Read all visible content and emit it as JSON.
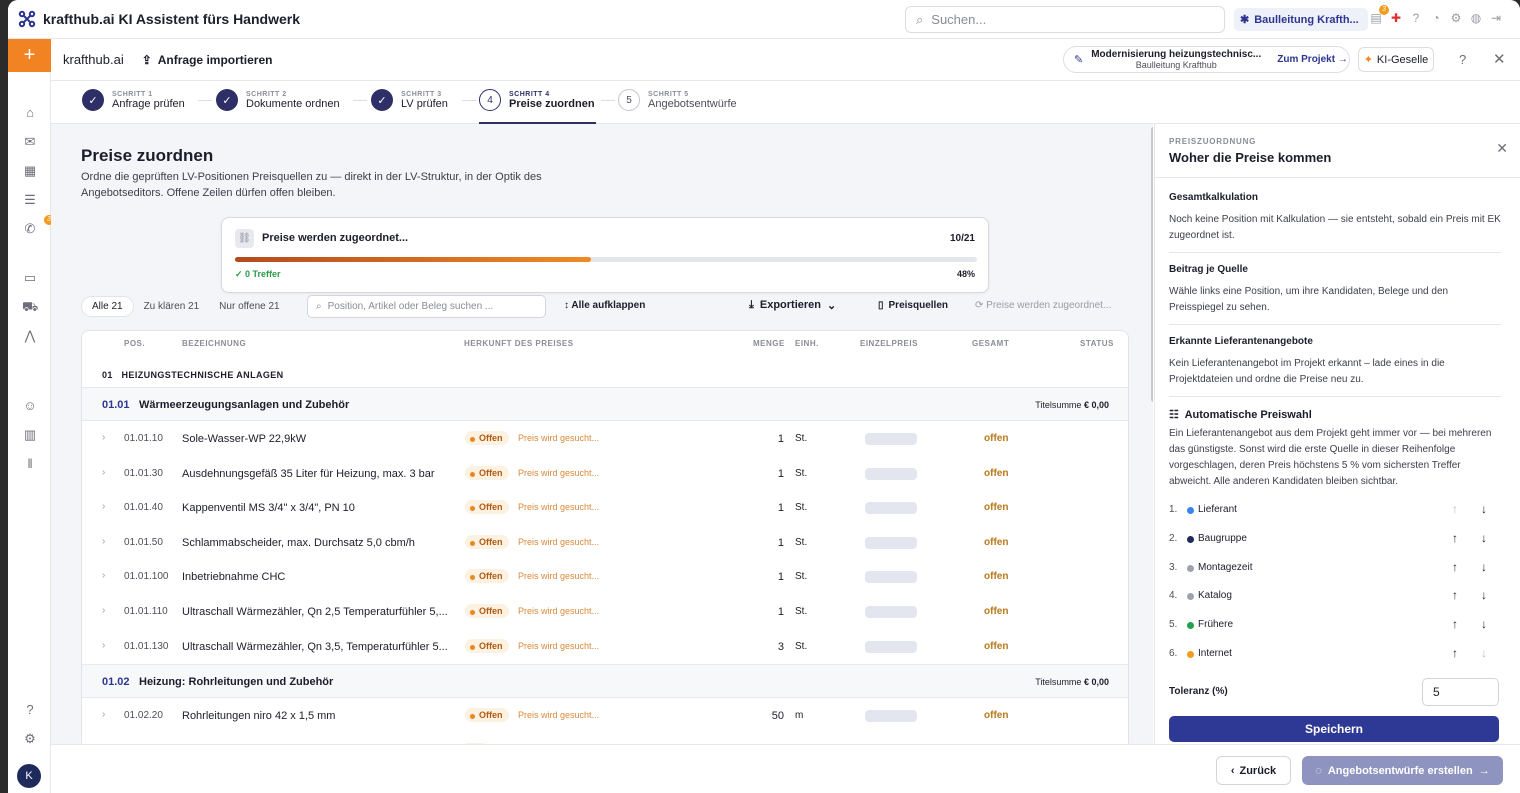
{
  "app": {
    "title": "krafthub.ai KI Assistent fürs Handwerk"
  },
  "topbar": {
    "search_placeholder": "Suchen...",
    "org": "Baulleitung Krafth...",
    "notif_count": "3"
  },
  "sidebar": {
    "plus": "+",
    "badge": "3",
    "avatar": "K"
  },
  "subbar": {
    "crumb": "krafthub.ai",
    "import": "Anfrage importieren",
    "project_title": "Modernisierung heizungstechnisc...",
    "project_sub": "Baulleitung Krafthub",
    "project_link": "Zum Projekt →",
    "ki": "KI-Geselle"
  },
  "steps": [
    {
      "kicker": "SCHRITT 1",
      "name": "Anfrage prüfen",
      "mark": "✓"
    },
    {
      "kicker": "SCHRITT 2",
      "name": "Dokumente ordnen",
      "mark": "✓"
    },
    {
      "kicker": "SCHRITT 3",
      "name": "LV prüfen",
      "mark": "✓"
    },
    {
      "kicker": "SCHRITT 4",
      "name": "Preise zuordnen",
      "mark": "4"
    },
    {
      "kicker": "SCHRITT 5",
      "name": "Angebotsentwürfe",
      "mark": "5"
    }
  ],
  "main": {
    "title": "Preise zuordnen",
    "intro": "Ordne die geprüften LV-Positionen Preisquellen zu — direkt in der LV-Struktur, in der Optik des Angebotseditors. Offene Zeilen dürfen offen bleiben."
  },
  "progress": {
    "title": "Preise werden zugeordnet...",
    "count": "10/21",
    "fraction": 0.48,
    "treffer": "✓ 0 Treffer",
    "pct": "48%"
  },
  "filters": {
    "all": "Alle 21",
    "clarify": "Zu klären 21",
    "open": "Nur offene 21",
    "search_placeholder": "Position, Artikel oder Beleg suchen ...",
    "expand": "Alle aufklappen",
    "export": "Exportieren",
    "sources": "Preisquellen",
    "status": "Preise werden zugeordnet..."
  },
  "table": {
    "headers": {
      "pos": "POS.",
      "bez": "BEZEICHNUNG",
      "herkunft": "HERKUNFT DES PREISES",
      "menge": "MENGE",
      "einh": "EINH.",
      "ep": "EINZELPREIS",
      "gesamt": "GESAMT",
      "status": "STATUS"
    },
    "group": "01   HEIZUNGSTECHNISCHE ANLAGEN",
    "sub1": {
      "id": "01.01",
      "name": "Wärmeerzeugungsanlagen und Zubehör",
      "sum_label": "Titelsumme",
      "sum": "€ 0,00"
    },
    "sub2": {
      "id": "01.02",
      "name": "Heizung: Rohrleitungen und Zubehör",
      "sum_label": "Titelsumme",
      "sum": "€ 0,00"
    },
    "rows": [
      {
        "pos": "01.01.10",
        "bez": "Sole-Wasser-WP 22,9kW",
        "tag": "Offen",
        "src": "Preis wird gesucht...",
        "menge": "1",
        "einh": "St.",
        "status": "offen"
      },
      {
        "pos": "01.01.30",
        "bez": "Ausdehnungsgefäß 35 Liter für Heizung, max. 3 bar",
        "tag": "Offen",
        "src": "Preis wird gesucht...",
        "menge": "1",
        "einh": "St.",
        "status": "offen"
      },
      {
        "pos": "01.01.40",
        "bez": "Kappenventil MS 3/4\" x 3/4\", PN 10",
        "tag": "Offen",
        "src": "Preis wird gesucht...",
        "menge": "1",
        "einh": "St.",
        "status": "offen"
      },
      {
        "pos": "01.01.50",
        "bez": "Schlammabscheider, max. Durchsatz 5,0 cbm/h",
        "tag": "Offen",
        "src": "Preis wird gesucht...",
        "menge": "1",
        "einh": "St.",
        "status": "offen"
      },
      {
        "pos": "01.01.100",
        "bez": "Inbetriebnahme CHC",
        "tag": "Offen",
        "src": "Preis wird gesucht...",
        "menge": "1",
        "einh": "St.",
        "status": "offen"
      },
      {
        "pos": "01.01.110",
        "bez": "Ultraschall Wärmezähler, Qn 2,5 Temperaturfühler 5,...",
        "tag": "Offen",
        "src": "Preis wird gesucht...",
        "menge": "1",
        "einh": "St.",
        "status": "offen"
      },
      {
        "pos": "01.01.130",
        "bez": "Ultraschall Wärmezähler, Qn 3,5, Temperaturfühler 5...",
        "tag": "Offen",
        "src": "Preis wird gesucht...",
        "menge": "3",
        "einh": "St.",
        "status": "offen"
      }
    ],
    "row2": {
      "pos": "01.02.20",
      "bez": "Rohrleitungen niro 42 x 1,5 mm",
      "tag": "Offen",
      "src": "Preis wird gesucht...",
      "menge": "50",
      "einh": "m",
      "status": "offen"
    }
  },
  "panel": {
    "kicker": "PREISZUORDNUNG",
    "title": "Woher die Preise kommen",
    "s1_title": "Gesamtkalkulation",
    "s1_text": "Noch keine Position mit Kalkulation — sie entsteht, sobald ein Preis mit EK zugeordnet ist.",
    "s2_title": "Beitrag je Quelle",
    "s2_text": "Wähle links eine Position, um ihre Kandidaten, Belege und den Preisspiegel zu sehen.",
    "s3_title": "Erkannte Lieferantenangebote",
    "s3_text": "Kein Lieferantenangebot im Projekt erkannt – lade eines in die Projektdateien und ordne die Preise neu zu.",
    "s4_title": "Automatische Preiswahl",
    "s4_text": "Ein Lieferantenangebot aus dem Projekt geht immer vor — bei mehreren das günstigste. Sonst wird die erste Quelle in dieser Reihenfolge vorgeschlagen, deren Preis höchstens 5 % vom sichersten Treffer abweicht. Alle anderen Kandidaten bleiben sichtbar.",
    "priorities": [
      {
        "n": "1.",
        "label": "Lieferant",
        "color": "#3b82f6"
      },
      {
        "n": "2.",
        "label": "Baugruppe",
        "color": "#1f2a5c"
      },
      {
        "n": "3.",
        "label": "Montagezeit",
        "color": "#9ca3af"
      },
      {
        "n": "4.",
        "label": "Katalog",
        "color": "#9ca3af"
      },
      {
        "n": "5.",
        "label": "Frühere",
        "color": "#22a04b"
      },
      {
        "n": "6.",
        "label": "Internet",
        "color": "#f39b1b"
      }
    ],
    "tol_label": "Toleranz (%)",
    "tol_value": "5",
    "save": "Speichern"
  },
  "footer": {
    "back": "Zurück",
    "next": "Angebotsentwürfe erstellen"
  }
}
